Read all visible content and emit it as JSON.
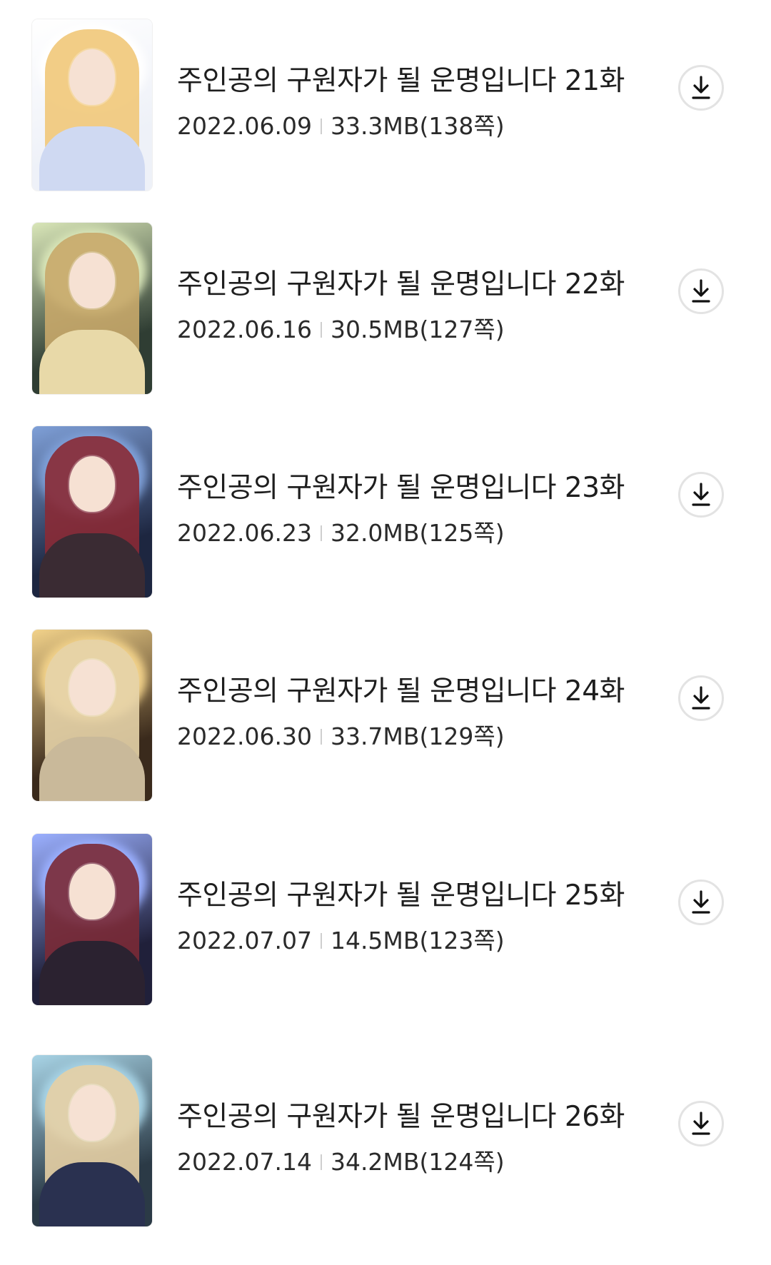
{
  "episodes": [
    {
      "title": "주인공의 구원자가 될 운명입니다 21화",
      "date": "2022.06.09",
      "size": "33.3MB(138쪽)",
      "cover": {
        "bg": "#eef1f8",
        "hair": "#f1c879",
        "dress": "#cfd9f2",
        "glow": "#ffffff"
      }
    },
    {
      "title": "주인공의 구원자가 될 운명입니다 22화",
      "date": "2022.06.16",
      "size": "30.5MB(127쪽)",
      "cover": {
        "bg": "#2f3d33",
        "hair": "#c8a86a",
        "dress": "#e8d9a8",
        "glow": "#d9e6b8"
      }
    },
    {
      "title": "주인공의 구원자가 될 운명입니다 23화",
      "date": "2022.06.23",
      "size": "32.0MB(125쪽)",
      "cover": {
        "bg": "#1d2640",
        "hair": "#8a2a35",
        "dress": "#3a2b33",
        "glow": "#7fa0d8"
      }
    },
    {
      "title": "주인공의 구원자가 될 운명입니다 24화",
      "date": "2022.06.30",
      "size": "33.7MB(129쪽)",
      "cover": {
        "bg": "#3a2a1c",
        "hair": "#e6d3a8",
        "dress": "#c9b99a",
        "glow": "#f2d28a"
      }
    },
    {
      "title": "주인공의 구원자가 될 운명입니다 25화",
      "date": "2022.07.07",
      "size": "14.5MB(123쪽)",
      "cover": {
        "bg": "#20203a",
        "hair": "#7a2a36",
        "dress": "#2b2230",
        "glow": "#9bb0ff"
      }
    },
    {
      "title": "주인공의 구원자가 될 운명입니다 26화",
      "date": "2022.07.14",
      "size": "34.2MB(124쪽)",
      "cover": {
        "bg": "#2b3a46",
        "hair": "#e6cfa4",
        "dress": "#2a3150",
        "glow": "#a8d4e6"
      }
    }
  ],
  "download_icon": "download-icon"
}
